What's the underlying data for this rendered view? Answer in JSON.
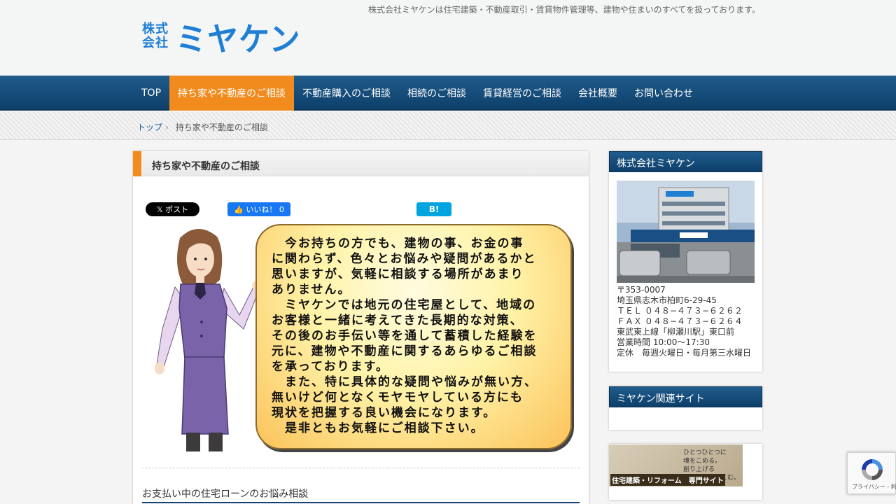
{
  "header": {
    "tagline": "株式会社ミヤケンは住宅建築・不動産取引・賃貸物件管理等、建物や住まいのすべてを扱っております。",
    "logo_small_1": "株式",
    "logo_small_2": "会社",
    "logo_main": "ミヤケン"
  },
  "nav": {
    "items": [
      {
        "label": "TOP"
      },
      {
        "label": "持ち家や不動産のご相談"
      },
      {
        "label": "不動産購入のご相談"
      },
      {
        "label": "相続のご相談"
      },
      {
        "label": "賃貸経営のご相談"
      },
      {
        "label": "会社概要"
      },
      {
        "label": "お問い合わせ"
      }
    ],
    "active_index": 1
  },
  "breadcrumb": {
    "home": "トップ",
    "separator": "›",
    "current": "持ち家や不動産のご相談"
  },
  "main": {
    "title": "持ち家や不動産のご相談",
    "share_x": "𝕏 ポスト",
    "share_fb": "👍 いいね！ 0",
    "share_hatena": "B!",
    "bubble_text": "　今お持ちの方でも、建物の事、お金の事\nに関わらず、色々とお悩みや疑問があるかと\n思いますが、気軽に相談する場所があまり\nありません。\n　ミヤケンでは地元の住宅屋として、地域の\nお客様と一緒に考えてきた長期的な対策、\nその後のお手伝い等を通して蓄積した経験を\n元に、建物や不動産に関するあらゆるご相談\nを承っております。\n　また、特に具体的な疑問や悩みが無い方、\n無いけど何となくモヤモヤしている方にも\n現状を把握する良い機会になります。\n　是非ともお気軽にご相談下さい。",
    "sub_heading": "お支払い中の住宅ローンのお悩み相談"
  },
  "sidebar": {
    "company": {
      "heading": "株式会社ミヤケン",
      "address": "〒353-0007\n埼玉県志木市柏町6-29-45\nＴＥＬ ０４８−４７３−６２６２\nＦＡＸ ０４８−４７３−６２６４\n東武東上線「柳瀬川駅」東口前\n営業時間 10:00～17:30\n定休　毎週火曜日・毎月第三水曜日"
    },
    "related": {
      "heading": "ミヤケン関連サイト"
    },
    "banner": {
      "quote": "ひとつひとつに\n魂をこめる。\n創り上げる\n家に命を吹きこむ。",
      "title": "住宅建築・リフォーム　専門サイト"
    }
  },
  "recaptcha": {
    "label": "プライバシー - 利用規約"
  },
  "colors": {
    "nav_bg": "#1f5c8c",
    "accent_orange": "#f28b1e",
    "brand_blue": "#1f7fd4"
  }
}
